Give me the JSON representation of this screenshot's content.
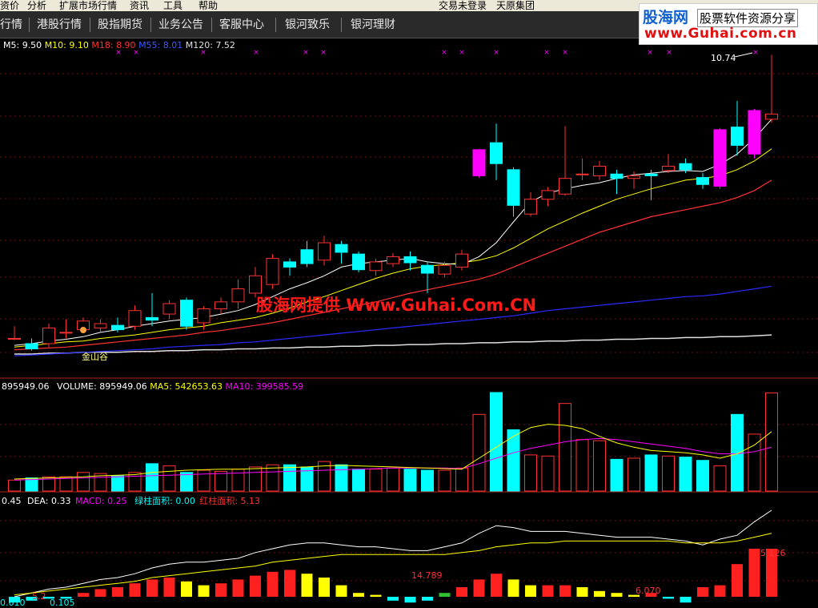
{
  "menu": {
    "items": [
      "资价",
      "分析",
      "扩展市场行情",
      "资讯",
      "工具",
      "帮助"
    ],
    "status": "交易未登录",
    "company": "天原集团"
  },
  "nav": {
    "tabs": [
      "行情",
      "港股行情",
      "股指期货",
      "业务公告",
      "客服中心",
      "银河致乐",
      "银河理财"
    ]
  },
  "logo": {
    "name": "股海网",
    "slogan": "股票软件资源分享",
    "url": "www.Guhai.com.cn"
  },
  "watermark": "股海网提供 Www.Guhai.Com.CN",
  "price_panel": {
    "ma5": "M5: 9.50",
    "ma10": "M10: 9.10",
    "ma18": "M18: 8.90",
    "ma55": "M55: 8.01",
    "ma120": "M120: 7.52",
    "high_label": "10.74",
    "signal_label": "金山谷"
  },
  "volume_panel": {
    "value_label": "895949.06",
    "volume": "VOLUME: 895949.06",
    "ma5": "MA5: 542653.63",
    "ma10": "MA10: 399585.59"
  },
  "macd_panel": {
    "dif": "0.45",
    "dea": "DEA: 0.33",
    "macd": "MACD: 0.25",
    "green_area": "绿柱面积: 0.00",
    "red_area": "红柱面积: 5.13",
    "labels": [
      "14.789",
      "6.070",
      "5.126",
      "0.610",
      "0.105",
      "5.2"
    ]
  },
  "colors": {
    "up": "#ff3232",
    "down": "#00ffff",
    "magenta": "#ff00ff",
    "ma5": "#ffffff",
    "ma10": "#ffff00",
    "ma18": "#ff3232",
    "ma55": "#2a2aff",
    "ma120": "#e0e0e0"
  },
  "chart_data": {
    "type": "candlestick",
    "candles": [
      {
        "o": 7.48,
        "c": 7.48,
        "h": 7.62,
        "l": 7.46
      },
      {
        "o": 7.42,
        "c": 7.36,
        "h": 7.48,
        "l": 7.34
      },
      {
        "o": 7.42,
        "c": 7.6,
        "h": 7.65,
        "l": 7.38
      },
      {
        "o": 7.55,
        "c": 7.55,
        "h": 7.7,
        "l": 7.48
      },
      {
        "o": 7.58,
        "c": 7.68,
        "h": 7.72,
        "l": 7.54
      },
      {
        "o": 7.6,
        "c": 7.65,
        "h": 7.7,
        "l": 7.56
      },
      {
        "o": 7.63,
        "c": 7.58,
        "h": 7.72,
        "l": 7.55
      },
      {
        "o": 7.62,
        "c": 7.8,
        "h": 7.86,
        "l": 7.58
      },
      {
        "o": 7.72,
        "c": 7.69,
        "h": 8.0,
        "l": 7.62
      },
      {
        "o": 7.76,
        "c": 7.88,
        "h": 7.92,
        "l": 7.7
      },
      {
        "o": 7.92,
        "c": 7.62,
        "h": 7.95,
        "l": 7.58
      },
      {
        "o": 7.66,
        "c": 7.82,
        "h": 7.85,
        "l": 7.58
      },
      {
        "o": 7.82,
        "c": 7.9,
        "h": 7.95,
        "l": 7.76
      },
      {
        "o": 7.9,
        "c": 8.05,
        "h": 8.16,
        "l": 7.82
      },
      {
        "o": 8.0,
        "c": 8.2,
        "h": 8.3,
        "l": 7.95
      },
      {
        "o": 8.1,
        "c": 8.4,
        "h": 8.45,
        "l": 8.05
      },
      {
        "o": 8.36,
        "c": 8.3,
        "h": 8.4,
        "l": 8.2
      },
      {
        "o": 8.5,
        "c": 8.34,
        "h": 8.6,
        "l": 8.3
      },
      {
        "o": 8.38,
        "c": 8.58,
        "h": 8.66,
        "l": 8.32
      },
      {
        "o": 8.56,
        "c": 8.47,
        "h": 8.6,
        "l": 8.34
      },
      {
        "o": 8.45,
        "c": 8.27,
        "h": 8.48,
        "l": 8.24
      },
      {
        "o": 8.26,
        "c": 8.36,
        "h": 8.4,
        "l": 8.2
      },
      {
        "o": 8.34,
        "c": 8.42,
        "h": 8.46,
        "l": 8.3
      },
      {
        "o": 8.42,
        "c": 8.35,
        "h": 8.48,
        "l": 8.26
      },
      {
        "o": 8.32,
        "c": 8.23,
        "h": 8.36,
        "l": 8.0
      },
      {
        "o": 8.22,
        "c": 8.32,
        "h": 8.36,
        "l": 8.18
      },
      {
        "o": 8.3,
        "c": 8.45,
        "h": 8.5,
        "l": 8.26
      },
      {
        "o": 9.35,
        "c": 9.65,
        "h": 9.66,
        "l": 9.33
      },
      {
        "o": 9.73,
        "c": 9.49,
        "h": 9.95,
        "l": 9.3
      },
      {
        "o": 9.42,
        "c": 9.01,
        "h": 9.45,
        "l": 8.88
      },
      {
        "o": 8.91,
        "c": 9.08,
        "h": 9.16,
        "l": 8.88
      },
      {
        "o": 9.08,
        "c": 9.18,
        "h": 9.22,
        "l": 9.0
      },
      {
        "o": 9.14,
        "c": 9.32,
        "h": 9.92,
        "l": 9.12
      },
      {
        "o": 9.37,
        "c": 9.37,
        "h": 9.55,
        "l": 9.3
      },
      {
        "o": 9.35,
        "c": 9.46,
        "h": 9.52,
        "l": 9.3
      },
      {
        "o": 9.37,
        "c": 9.32,
        "h": 9.42,
        "l": 9.14
      },
      {
        "o": 9.32,
        "c": 9.35,
        "h": 9.4,
        "l": 9.2
      },
      {
        "o": 9.37,
        "c": 9.35,
        "h": 9.42,
        "l": 9.07
      },
      {
        "o": 9.41,
        "c": 9.46,
        "h": 9.6,
        "l": 9.38
      },
      {
        "o": 9.49,
        "c": 9.42,
        "h": 9.55,
        "l": 9.38
      },
      {
        "o": 9.33,
        "c": 9.25,
        "h": 9.38,
        "l": 9.2
      },
      {
        "o": 9.23,
        "c": 9.88,
        "h": 9.9,
        "l": 9.2
      },
      {
        "o": 9.91,
        "c": 9.7,
        "h": 10.21,
        "l": 9.58
      },
      {
        "o": 9.6,
        "c": 10.1,
        "h": 10.12,
        "l": 9.55
      },
      {
        "o": 10.0,
        "c": 10.06,
        "h": 10.74,
        "l": 9.96
      }
    ],
    "ma5": [
      7.4,
      7.42,
      7.45,
      7.47,
      7.5,
      7.55,
      7.58,
      7.62,
      7.65,
      7.68,
      7.7,
      7.72,
      7.76,
      7.8,
      7.87,
      7.96,
      8.05,
      8.12,
      8.2,
      8.3,
      8.34,
      8.36,
      8.38,
      8.4,
      8.36,
      8.34,
      8.33,
      8.42,
      8.58,
      8.82,
      9.05,
      9.15,
      9.2,
      9.24,
      9.27,
      9.32,
      9.36,
      9.38,
      9.4,
      9.41,
      9.4,
      9.48,
      9.6,
      9.78,
      10.0
    ],
    "ma10": [
      7.38,
      7.4,
      7.42,
      7.44,
      7.45,
      7.48,
      7.5,
      7.52,
      7.55,
      7.58,
      7.6,
      7.62,
      7.66,
      7.69,
      7.72,
      7.77,
      7.83,
      7.9,
      7.96,
      8.03,
      8.1,
      8.17,
      8.23,
      8.28,
      8.31,
      8.33,
      8.35,
      8.38,
      8.43,
      8.52,
      8.63,
      8.74,
      8.83,
      8.92,
      9.0,
      9.08,
      9.14,
      9.2,
      9.25,
      9.3,
      9.32,
      9.35,
      9.42,
      9.52,
      9.66
    ],
    "ma18": [
      7.35,
      7.36,
      7.37,
      7.38,
      7.4,
      7.42,
      7.44,
      7.46,
      7.48,
      7.5,
      7.52,
      7.55,
      7.57,
      7.6,
      7.63,
      7.66,
      7.7,
      7.74,
      7.78,
      7.82,
      7.86,
      7.9,
      7.95,
      8.0,
      8.04,
      8.08,
      8.12,
      8.16,
      8.22,
      8.3,
      8.38,
      8.46,
      8.54,
      8.62,
      8.7,
      8.76,
      8.82,
      8.88,
      8.92,
      8.96,
      9.0,
      9.04,
      9.1,
      9.18,
      9.3
    ],
    "ma55": [
      7.28,
      7.29,
      7.3,
      7.31,
      7.32,
      7.33,
      7.34,
      7.35,
      7.36,
      7.38,
      7.39,
      7.4,
      7.41,
      7.43,
      7.44,
      7.46,
      7.48,
      7.5,
      7.52,
      7.54,
      7.56,
      7.58,
      7.6,
      7.62,
      7.64,
      7.66,
      7.68,
      7.7,
      7.72,
      7.74,
      7.77,
      7.8,
      7.82,
      7.84,
      7.86,
      7.88,
      7.9,
      7.92,
      7.94,
      7.96,
      7.97,
      7.99,
      8.02,
      8.05,
      8.08
    ],
    "ma120": [
      7.3,
      7.3,
      7.31,
      7.31,
      7.32,
      7.32,
      7.32,
      7.33,
      7.33,
      7.34,
      7.34,
      7.35,
      7.35,
      7.36,
      7.36,
      7.37,
      7.37,
      7.38,
      7.38,
      7.39,
      7.39,
      7.4,
      7.4,
      7.41,
      7.41,
      7.42,
      7.42,
      7.43,
      7.43,
      7.44,
      7.44,
      7.45,
      7.45,
      7.46,
      7.46,
      7.47,
      7.47,
      7.48,
      7.48,
      7.49,
      7.49,
      7.5,
      7.5,
      7.51,
      7.52
    ],
    "volume": [
      100000,
      120000,
      130000,
      130000,
      170000,
      160000,
      140000,
      170000,
      250000,
      230000,
      170000,
      190000,
      180000,
      200000,
      220000,
      240000,
      240000,
      220000,
      270000,
      240000,
      200000,
      200000,
      210000,
      200000,
      190000,
      190000,
      210000,
      700000,
      900000,
      560000,
      330000,
      320000,
      800000,
      470000,
      460000,
      290000,
      300000,
      330000,
      320000,
      310000,
      280000,
      230000,
      700000,
      520000,
      895949.06
    ],
    "vol_ma5": [
      110000,
      115000,
      120000,
      125000,
      130000,
      140000,
      145000,
      150000,
      170000,
      180000,
      190000,
      195000,
      200000,
      200000,
      205000,
      210000,
      215000,
      220000,
      230000,
      235000,
      230000,
      225000,
      220000,
      215000,
      210000,
      205000,
      200000,
      300000,
      400000,
      500000,
      580000,
      610000,
      600000,
      570000,
      500000,
      440000,
      400000,
      370000,
      360000,
      350000,
      330000,
      300000,
      340000,
      420000,
      542653.63
    ],
    "vol_ma10": [
      100000,
      105000,
      110000,
      115000,
      120000,
      125000,
      130000,
      135000,
      140000,
      145000,
      150000,
      155000,
      160000,
      165000,
      170000,
      175000,
      180000,
      185000,
      190000,
      195000,
      200000,
      205000,
      210000,
      210000,
      210000,
      210000,
      205000,
      250000,
      300000,
      350000,
      390000,
      420000,
      450000,
      470000,
      480000,
      470000,
      450000,
      430000,
      410000,
      390000,
      360000,
      340000,
      340000,
      360000,
      399585.59
    ],
    "macd": [
      -0.03,
      -0.02,
      -0.01,
      -0.01,
      0.02,
      0.04,
      0.05,
      0.07,
      0.09,
      0.1,
      0.08,
      0.06,
      0.07,
      0.09,
      0.11,
      0.13,
      0.14,
      0.12,
      0.1,
      0.06,
      0.02,
      0.01,
      -0.02,
      -0.03,
      -0.02,
      0.02,
      0.05,
      0.09,
      0.12,
      0.09,
      0.06,
      0.06,
      0.06,
      0.05,
      0.03,
      0.02,
      0.01,
      0.02,
      -0.01,
      -0.03,
      0.05,
      0.06,
      0.17,
      0.25,
      0.25
    ],
    "dif": [
      0.0,
      0.02,
      0.04,
      0.05,
      0.07,
      0.09,
      0.1,
      0.12,
      0.15,
      0.17,
      0.18,
      0.18,
      0.19,
      0.2,
      0.23,
      0.25,
      0.27,
      0.28,
      0.28,
      0.27,
      0.26,
      0.26,
      0.25,
      0.24,
      0.24,
      0.26,
      0.28,
      0.33,
      0.37,
      0.36,
      0.34,
      0.34,
      0.34,
      0.33,
      0.32,
      0.31,
      0.31,
      0.31,
      0.3,
      0.29,
      0.27,
      0.3,
      0.32,
      0.39,
      0.45
    ],
    "dea": [
      0.01,
      0.02,
      0.03,
      0.04,
      0.05,
      0.06,
      0.07,
      0.08,
      0.1,
      0.11,
      0.12,
      0.13,
      0.14,
      0.15,
      0.16,
      0.18,
      0.19,
      0.2,
      0.21,
      0.22,
      0.22,
      0.22,
      0.22,
      0.22,
      0.22,
      0.22,
      0.23,
      0.24,
      0.26,
      0.27,
      0.28,
      0.28,
      0.29,
      0.29,
      0.29,
      0.29,
      0.29,
      0.29,
      0.29,
      0.28,
      0.28,
      0.28,
      0.29,
      0.31,
      0.33
    ]
  }
}
